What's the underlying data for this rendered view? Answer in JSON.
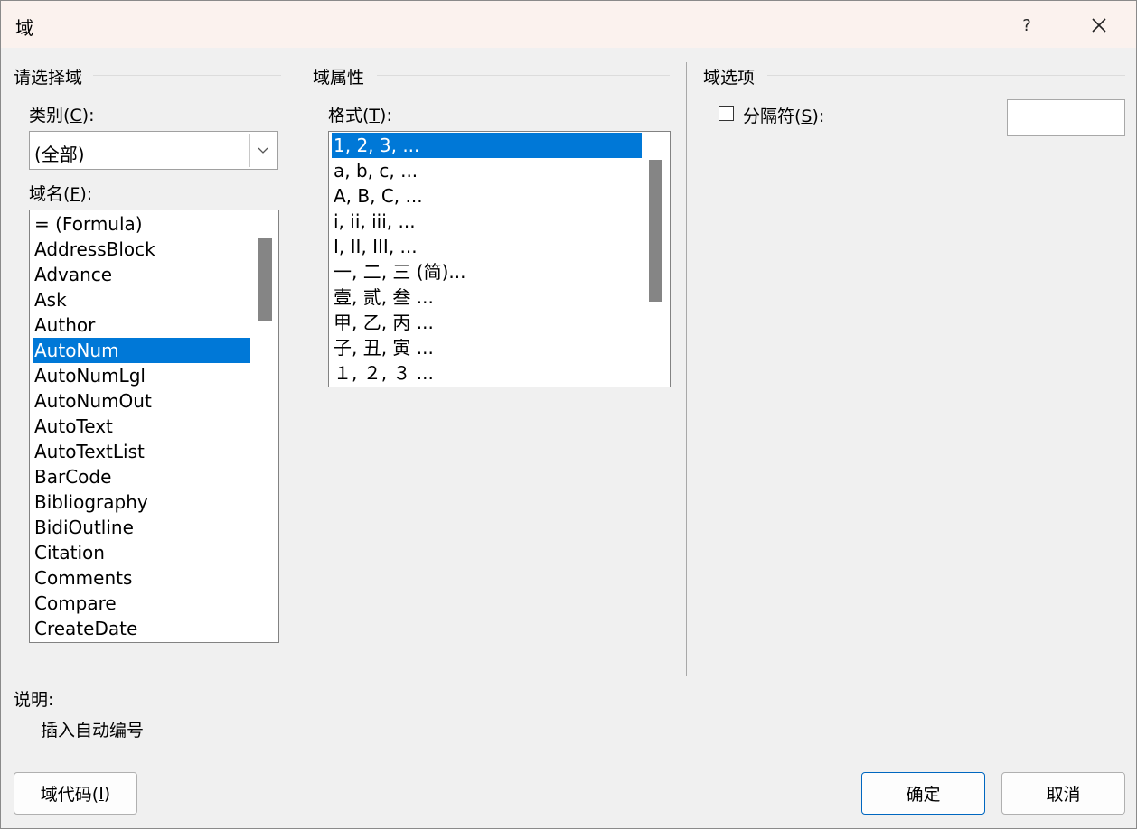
{
  "window": {
    "title": "域",
    "help_label": "?",
    "close_label": "✕"
  },
  "left": {
    "section_title": "请选择域",
    "category_label_pre": "类别(",
    "category_key": "C",
    "category_label_post": "):",
    "category_value": "(全部)",
    "fieldname_label_pre": "域名(",
    "fieldname_key": "F",
    "fieldname_label_post": "):",
    "fields": [
      "= (Formula)",
      "AddressBlock",
      "Advance",
      "Ask",
      "Author",
      "AutoNum",
      "AutoNumLgl",
      "AutoNumOut",
      "AutoText",
      "AutoTextList",
      "BarCode",
      "Bibliography",
      "BidiOutline",
      "Citation",
      "Comments",
      "Compare",
      "CreateDate"
    ],
    "selected_field": "AutoNum"
  },
  "middle": {
    "section_title": "域属性",
    "format_label_pre": "格式(",
    "format_key": "T",
    "format_label_post": "):",
    "formats": [
      "1, 2, 3, ...",
      "a, b, c, ...",
      "A, B, C, ...",
      "i, ii, iii, ...",
      "I, II, III, ...",
      "一, 二, 三 (简)...",
      "壹, 贰, 叁 ...",
      "甲, 乙, 丙 ...",
      "子, 丑, 寅 ...",
      "１, ２, ３ ..."
    ],
    "selected_format": "1, 2, 3, ..."
  },
  "right": {
    "section_title": "域选项",
    "separator_label_pre": "分隔符(",
    "separator_key": "S",
    "separator_label_post": "):",
    "separator_checked": false,
    "separator_value": ""
  },
  "description": {
    "label": "说明:",
    "text": "插入自动编号"
  },
  "buttons": {
    "field_codes_pre": "域代码(",
    "field_codes_key": "I",
    "field_codes_post": ")",
    "ok": "确定",
    "cancel": "取消"
  },
  "colors": {
    "selection": "#0078d7",
    "default_button_border": "#0067c0",
    "titlebar": "#fbf2ee",
    "dialog_bg": "#f0f0f0"
  }
}
